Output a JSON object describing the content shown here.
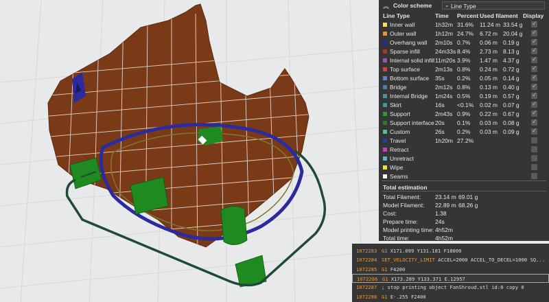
{
  "legend": {
    "collapse_icon": "chevron-up-icon",
    "scheme_label": "Color scheme",
    "scheme_value": "Line Type",
    "columns": {
      "type": "Line Type",
      "time": "Time",
      "percent": "Percent",
      "used": "Used filament",
      "display": "Display"
    },
    "rows": [
      {
        "name": "Inner wall",
        "time": "1h32m",
        "percent": "31.6%",
        "length": "11.24 m",
        "weight": "33.54 g",
        "color": "#f2e24c",
        "visible": true
      },
      {
        "name": "Outer wall",
        "time": "1h12m",
        "percent": "24.7%",
        "length": "6.72 m",
        "weight": "20.04 g",
        "color": "#e9923a",
        "visible": true
      },
      {
        "name": "Overhang wall",
        "time": "2m10s",
        "percent": "0.7%",
        "length": "0.06 m",
        "weight": "0.19 g",
        "color": "#2b2b9e",
        "visible": true
      },
      {
        "name": "Sparse infill",
        "time": "24m33s",
        "percent": "8.4%",
        "length": "2.73 m",
        "weight": "8.13 g",
        "color": "#a8362e",
        "visible": true
      },
      {
        "name": "Internal solid infill",
        "time": "11m20s",
        "percent": "3.9%",
        "length": "1.47 m",
        "weight": "4.37 g",
        "color": "#9456b0",
        "visible": true
      },
      {
        "name": "Top surface",
        "time": "2m13s",
        "percent": "0.8%",
        "length": "0.24 m",
        "weight": "0.72 g",
        "color": "#d8423c",
        "visible": true
      },
      {
        "name": "Bottom surface",
        "time": "35s",
        "percent": "0.2%",
        "length": "0.05 m",
        "weight": "0.14 g",
        "color": "#6a7bd0",
        "visible": true
      },
      {
        "name": "Bridge",
        "time": "2m12s",
        "percent": "0.8%",
        "length": "0.13 m",
        "weight": "0.40 g",
        "color": "#4d7ea8",
        "visible": true
      },
      {
        "name": "Internal Bridge",
        "time": "1m24s",
        "percent": "0.5%",
        "length": "0.19 m",
        "weight": "0.57 g",
        "color": "#4d8fa0",
        "visible": true
      },
      {
        "name": "Skirt",
        "time": "16s",
        "percent": "<0.1%",
        "length": "0.02 m",
        "weight": "0.07 g",
        "color": "#3b9a96",
        "visible": true
      },
      {
        "name": "Support",
        "time": "2m43s",
        "percent": "0.9%",
        "length": "0.22 m",
        "weight": "0.67 g",
        "color": "#2c9a2c",
        "visible": true
      },
      {
        "name": "Support interface",
        "time": "20s",
        "percent": "0.1%",
        "length": "0.03 m",
        "weight": "0.08 g",
        "color": "#2a7a2a",
        "visible": true
      },
      {
        "name": "Custom",
        "time": "26s",
        "percent": "0.2%",
        "length": "0.03 m",
        "weight": "0.09 g",
        "color": "#52c08c",
        "visible": true
      },
      {
        "name": "Travel",
        "time": "1h20m",
        "percent": "27.2%",
        "length": "",
        "weight": "",
        "color": "#2340a0",
        "visible": false
      },
      {
        "name": "Retract",
        "time": "",
        "percent": "",
        "length": "",
        "weight": "",
        "color": "#c43bc4",
        "visible": false
      },
      {
        "name": "Unretract",
        "time": "",
        "percent": "",
        "length": "",
        "weight": "",
        "color": "#5fb0cc",
        "visible": false
      },
      {
        "name": "Wipe",
        "time": "",
        "percent": "",
        "length": "",
        "weight": "",
        "color": "#f0e02c",
        "visible": false
      },
      {
        "name": "Seams",
        "time": "",
        "percent": "",
        "length": "",
        "weight": "",
        "color": "#f4f4f4",
        "visible": false
      }
    ],
    "total_title": "Total estimation",
    "stats": [
      {
        "label": "Total Filament:",
        "value": "23.14 m",
        "value2": "69.01 g"
      },
      {
        "label": "Model Filament:",
        "value": "22.89 m",
        "value2": "68.26 g"
      },
      {
        "label": "Cost:",
        "value": "1.38",
        "value2": ""
      },
      {
        "label": "Prepare time:",
        "value": "24s",
        "value2": ""
      },
      {
        "label": "Model printing time:",
        "value": "4h52m",
        "value2": ""
      },
      {
        "label": "Total time:",
        "value": "4h52m",
        "value2": ""
      }
    ]
  },
  "gcode": {
    "lines": [
      {
        "num": "1072283",
        "cmd": "G1",
        "args": "X171.099 Y131.181 F18000",
        "selected": false
      },
      {
        "num": "1072284",
        "cmd": "SET_VELOCITY_LIMIT",
        "args": "ACCEL=2000 ACCEL_TO_DECEL=1000 SQ...",
        "selected": false
      },
      {
        "num": "1072285",
        "cmd": "G1",
        "args": "F4200",
        "selected": false
      },
      {
        "num": "1072286",
        "cmd": "G1",
        "args": "X173.289 Y133.371 E.12957",
        "selected": true
      },
      {
        "num": "1072287",
        "cmd": "",
        "args": "; stop printing object FanShroud.stl id:0 copy 0",
        "selected": false
      },
      {
        "num": "1072288",
        "cmd": "G1",
        "args": "E-.255 F2400",
        "selected": false
      }
    ]
  },
  "colors": {
    "model": "#7b3a17",
    "support": "#1f8a1f",
    "overhang": "#2b2b9e",
    "skirt": "#1f4a3a",
    "panel_bg": "#2e2e30",
    "gcode_accent": "#e39a43"
  }
}
